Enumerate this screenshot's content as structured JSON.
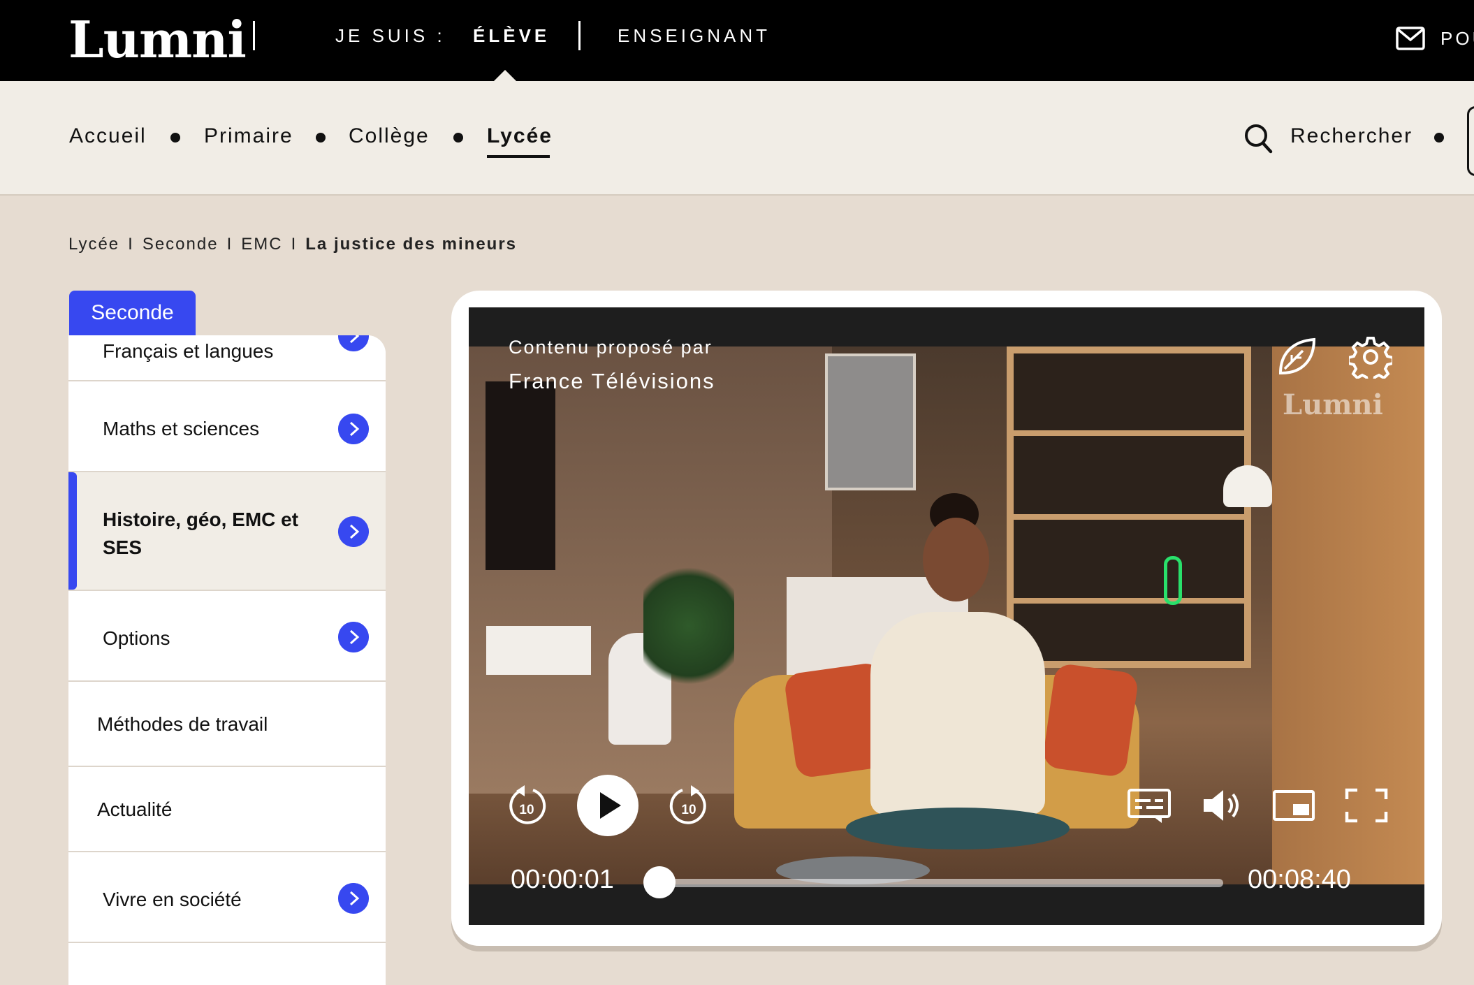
{
  "header": {
    "logo": "Lumni",
    "je_suis": "JE SUIS :",
    "eleve": "ÉLÈVE",
    "enseignant": "ENSEIGNANT",
    "right_text": "POU"
  },
  "nav": {
    "items": [
      {
        "label": "Accueil"
      },
      {
        "label": "Primaire"
      },
      {
        "label": "Collège"
      },
      {
        "label": "Lycée"
      }
    ],
    "search_label": "Rechercher"
  },
  "breadcrumb": [
    "Lycée",
    "Seconde",
    "EMC",
    "La justice des mineurs"
  ],
  "sidebar": {
    "tab": "Seconde",
    "items": [
      {
        "label": "Français et langues"
      },
      {
        "label": "Maths et sciences"
      },
      {
        "label": "Histoire, géo, EMC et"
      },
      {
        "label": "Options"
      },
      {
        "label": "Méthodes de travail"
      },
      {
        "label": "Actualité"
      },
      {
        "label": "Vivre en société"
      }
    ],
    "active_item_second_line": "SES"
  },
  "video": {
    "provider_line1": "Contenu proposé par",
    "provider_line2": "France Télévisions",
    "watermark": "Lumni",
    "rewind_seconds": "10",
    "forward_seconds": "10",
    "current_time": "00:00:01",
    "duration": "00:08:40",
    "progress": 0.002
  },
  "colors": {
    "accent": "#3748f0",
    "topbar": "#000000",
    "subnav": "#f1ede6",
    "page_bg": "#e6dcd1"
  }
}
